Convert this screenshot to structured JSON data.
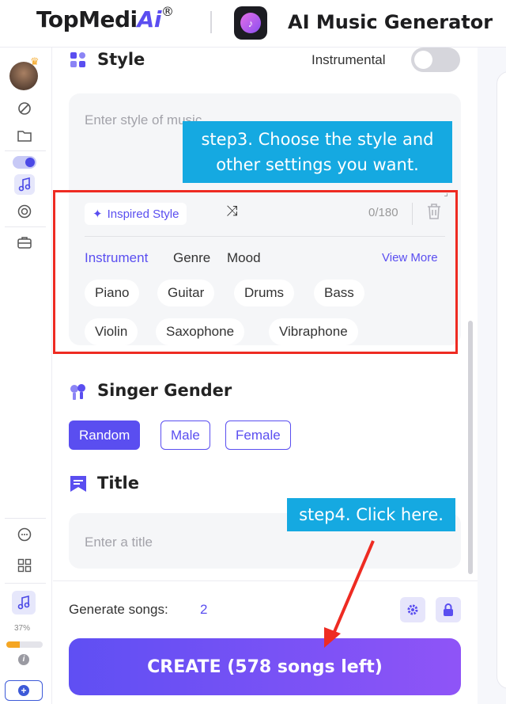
{
  "header": {
    "brand_name": "TopMedi",
    "brand_ai": "Ai",
    "brand_reg": "®",
    "app_title": "AI Music Generator"
  },
  "rail": {
    "progress_label": "37%",
    "progress_value": 0.37,
    "icons": [
      "avatar",
      "no-music-icon",
      "folder-icon",
      "toggle",
      "music-note-icon",
      "vinyl-icon",
      "toolbox-icon",
      "chat-icon",
      "apps-icon",
      "music-file-icon",
      "info-icon",
      "add-icon"
    ]
  },
  "style": {
    "title": "Style",
    "instrumental_label": "Instrumental",
    "instrumental_on": false,
    "placeholder": "Enter style of music",
    "inspired_label": "Inspired Style",
    "counter": "0/180",
    "tabs": [
      "Instrument",
      "Genre",
      "Mood"
    ],
    "active_tab": "Instrument",
    "view_more": "View More",
    "chips": [
      "Piano",
      "Guitar",
      "Drums",
      "Bass",
      "Violin",
      "Saxophone",
      "Vibraphone"
    ]
  },
  "singer": {
    "title": "Singer Gender",
    "options": [
      "Random",
      "Male",
      "Female"
    ],
    "selected": "Random"
  },
  "title_section": {
    "title": "Title",
    "placeholder": "Enter a title"
  },
  "footer": {
    "generate_label": "Generate songs:",
    "generate_count": "2",
    "create_label": "CREATE (578 songs left)"
  },
  "annotations": {
    "step3": "step3. Choose the style and other settings you want.",
    "step3_line1": "step3. Choose the style and",
    "step3_line2": "other settings you want.",
    "step4": "step4. Click here."
  },
  "colors": {
    "accent": "#5a4ef0",
    "callout": "#15a9e1",
    "highlight": "#ee2b22",
    "progress": "#f5a623"
  }
}
